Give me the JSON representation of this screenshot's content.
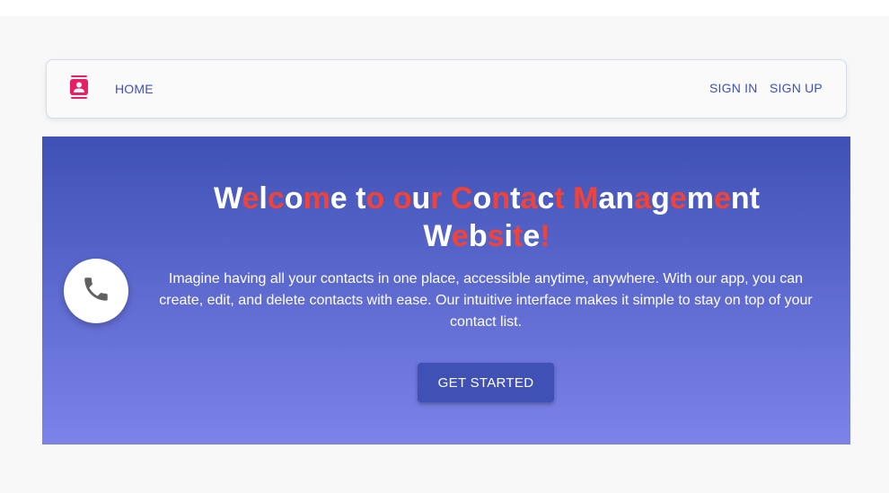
{
  "nav": {
    "logo_icon": "contact-card-icon",
    "home_label": "HOME",
    "signin_label": "SIGN IN",
    "signup_label": "SIGN UP",
    "link_color": "#3f51b5",
    "logo_color": "#e91e63"
  },
  "hero": {
    "title_line1_words": [
      [
        [
          "W",
          "w"
        ],
        [
          "e",
          "r"
        ],
        [
          "l",
          "w"
        ],
        [
          "c",
          "r"
        ],
        [
          "o",
          "w"
        ],
        [
          "m",
          "r"
        ],
        [
          "e",
          "w"
        ]
      ],
      [
        [
          "t",
          "w"
        ],
        [
          "o",
          "r"
        ]
      ],
      [
        [
          "o",
          "r"
        ],
        [
          "u",
          "w"
        ],
        [
          "r",
          "r"
        ]
      ],
      [
        [
          "C",
          "r"
        ],
        [
          "o",
          "w"
        ],
        [
          "n",
          "r"
        ],
        [
          "t",
          "w"
        ],
        [
          "a",
          "r"
        ],
        [
          "c",
          "w"
        ],
        [
          "t",
          "r"
        ]
      ],
      [
        [
          "M",
          "r"
        ],
        [
          "a",
          "w"
        ],
        [
          "n",
          "w"
        ],
        [
          "a",
          "r"
        ],
        [
          "g",
          "w"
        ],
        [
          "e",
          "r"
        ],
        [
          "m",
          "w"
        ],
        [
          "e",
          "r"
        ],
        [
          "n",
          "w"
        ],
        [
          "t",
          "w"
        ]
      ]
    ],
    "title_line2_words": [
      [
        [
          "W",
          "w"
        ],
        [
          "e",
          "r"
        ],
        [
          "b",
          "w"
        ],
        [
          "s",
          "r"
        ],
        [
          "i",
          "w"
        ],
        [
          "t",
          "r"
        ],
        [
          "e",
          "w"
        ],
        [
          "!",
          "r"
        ]
      ]
    ],
    "title_text": "Welcome to our Contact Management Website!",
    "description": "Imagine having all your contacts in one place, accessible anytime, anywhere. With our app, you can create, edit, and delete contacts with ease. Our intuitive interface makes it simple to stay on top of your contact list.",
    "cta_label": "GET STARTED",
    "phone_icon": "phone-icon",
    "gradient_top": "#3f51b5",
    "gradient_bottom": "#7c83e9",
    "accent_red": "#f44336"
  }
}
